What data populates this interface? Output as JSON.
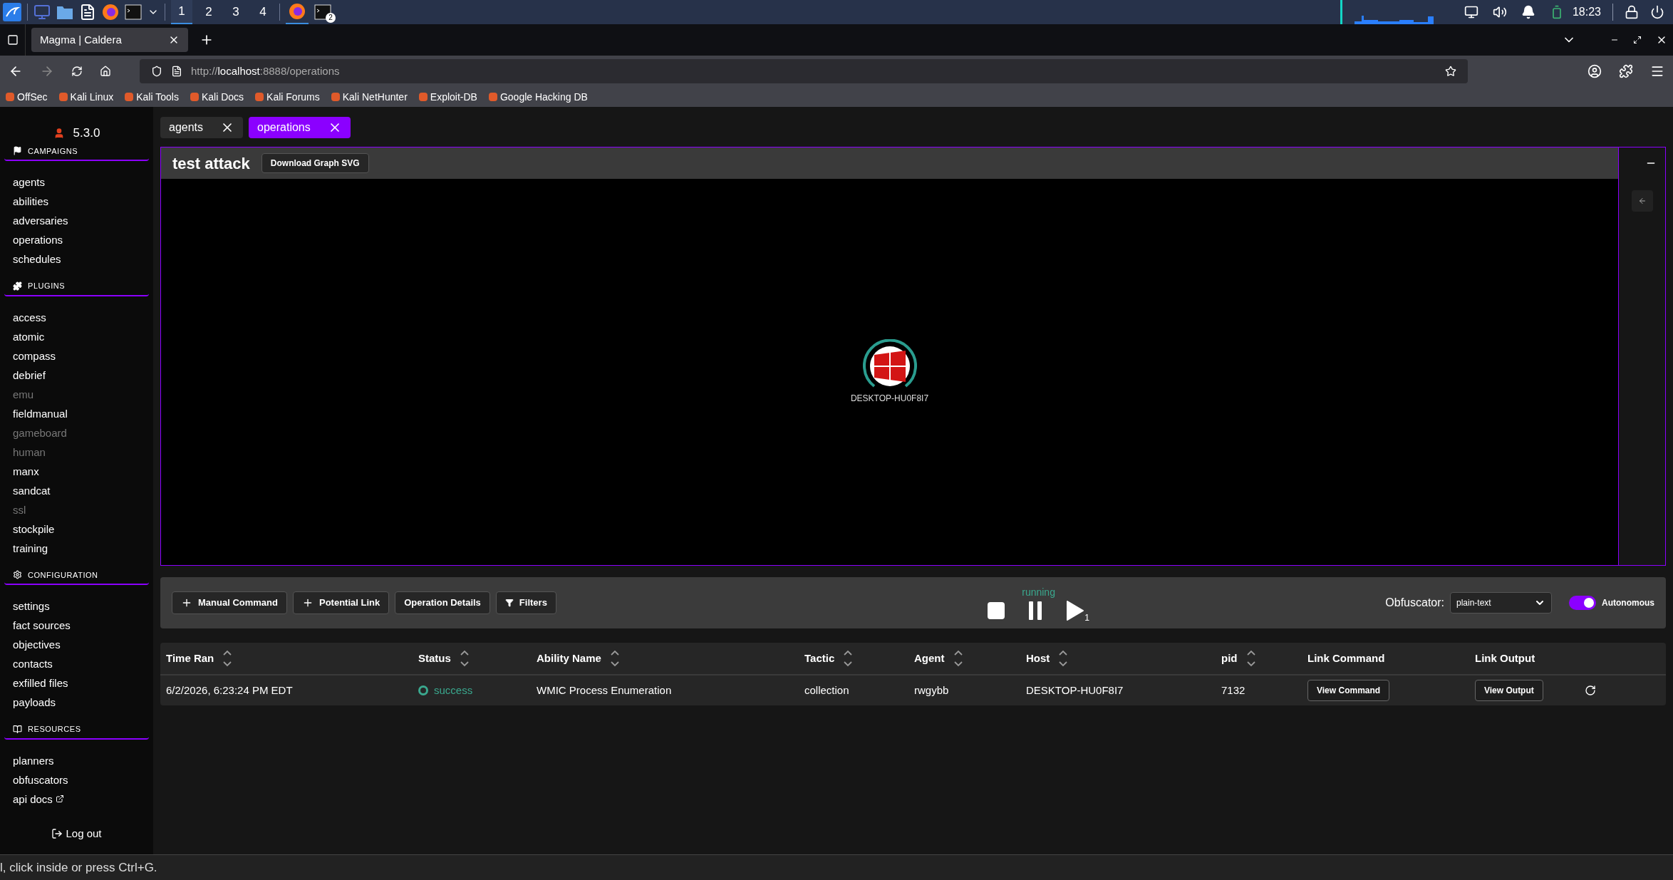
{
  "taskbar": {
    "workspaces": [
      {
        "label": "1",
        "selected": true
      },
      {
        "label": "2",
        "selected": false
      },
      {
        "label": "3",
        "selected": false
      },
      {
        "label": "4",
        "selected": false
      }
    ],
    "terminal_badge": "2",
    "clock": "18:23"
  },
  "browser": {
    "tab_title": "Magma | Caldera",
    "url_scheme": "http://",
    "url_host": "localhost",
    "url_rest": ":8888/operations",
    "bookmarks": [
      "OffSec",
      "Kali Linux",
      "Kali Tools",
      "Kali Docs",
      "Kali Forums",
      "Kali NetHunter",
      "Exploit-DB",
      "Google Hacking DB"
    ]
  },
  "sidebar": {
    "version": "5.3.0",
    "sections": [
      {
        "title": "CAMPAIGNS",
        "kind": "flag",
        "items": [
          {
            "label": "agents",
            "disabled": false,
            "external": false
          },
          {
            "label": "abilities",
            "disabled": false,
            "external": false
          },
          {
            "label": "adversaries",
            "disabled": false,
            "external": false
          },
          {
            "label": "operations",
            "disabled": false,
            "external": false
          },
          {
            "label": "schedules",
            "disabled": false,
            "external": false
          }
        ]
      },
      {
        "title": "PLUGINS",
        "kind": "puzzle",
        "items": [
          {
            "label": "access",
            "disabled": false,
            "external": false
          },
          {
            "label": "atomic",
            "disabled": false,
            "external": false
          },
          {
            "label": "compass",
            "disabled": false,
            "external": false
          },
          {
            "label": "debrief",
            "disabled": false,
            "external": false
          },
          {
            "label": "emu",
            "disabled": true,
            "external": false
          },
          {
            "label": "fieldmanual",
            "disabled": false,
            "external": false
          },
          {
            "label": "gameboard",
            "disabled": true,
            "external": false
          },
          {
            "label": "human",
            "disabled": true,
            "external": false
          },
          {
            "label": "manx",
            "disabled": false,
            "external": false
          },
          {
            "label": "sandcat",
            "disabled": false,
            "external": false
          },
          {
            "label": "ssl",
            "disabled": true,
            "external": false
          },
          {
            "label": "stockpile",
            "disabled": false,
            "external": false
          },
          {
            "label": "training",
            "disabled": false,
            "external": false
          }
        ]
      },
      {
        "title": "CONFIGURATION",
        "kind": "gear",
        "items": [
          {
            "label": "settings",
            "disabled": false,
            "external": false
          },
          {
            "label": "fact sources",
            "disabled": false,
            "external": false
          },
          {
            "label": "objectives",
            "disabled": false,
            "external": false
          },
          {
            "label": "contacts",
            "disabled": false,
            "external": false
          },
          {
            "label": "exfilled files",
            "disabled": false,
            "external": false
          },
          {
            "label": "payloads",
            "disabled": false,
            "external": false
          }
        ]
      },
      {
        "title": "RESOURCES",
        "kind": "book",
        "items": [
          {
            "label": "planners",
            "disabled": false,
            "external": false
          },
          {
            "label": "obfuscators",
            "disabled": false,
            "external": false
          },
          {
            "label": "api docs",
            "disabled": false,
            "external": true
          }
        ]
      }
    ],
    "logout": "Log out"
  },
  "page_tabs": [
    {
      "label": "agents",
      "selected": false
    },
    {
      "label": "operations",
      "selected": true
    }
  ],
  "graph": {
    "title": "test attack",
    "download_button": "Download Graph SVG",
    "node_label": "DESKTOP-HU0F8I7"
  },
  "controls": {
    "buttons": [
      {
        "label": "Manual Command",
        "kind": "plus"
      },
      {
        "label": "Potential Link",
        "kind": "plus"
      },
      {
        "label": "Operation Details",
        "kind": "none"
      },
      {
        "label": "Filters",
        "kind": "filter"
      }
    ],
    "state": "running",
    "play_count": "1",
    "obfuscator_label": "Obfuscator:",
    "obfuscator_value": "plain-text",
    "autonomous": {
      "label": "Autonomous",
      "on": true
    }
  },
  "table": {
    "columns": [
      {
        "label": "Time Ran",
        "sortable": true
      },
      {
        "label": "Status",
        "sortable": true
      },
      {
        "label": "Ability Name",
        "sortable": true
      },
      {
        "label": "Tactic",
        "sortable": true
      },
      {
        "label": "Agent",
        "sortable": true
      },
      {
        "label": "Host",
        "sortable": true
      },
      {
        "label": "pid",
        "sortable": true
      },
      {
        "label": "Link Command",
        "sortable": false
      },
      {
        "label": "Link Output",
        "sortable": false
      }
    ],
    "rows": [
      {
        "time": "6/2/2026, 6:23:24 PM EDT",
        "status": "success",
        "ability": "WMIC Process Enumeration",
        "tactic": "collection",
        "agent": "rwgybb",
        "host": "DESKTOP-HU0F8I7",
        "pid": "7132",
        "command_button": "View Command",
        "output_button": "View Output"
      }
    ]
  },
  "status_bar": "l, click inside or press Ctrl+G."
}
